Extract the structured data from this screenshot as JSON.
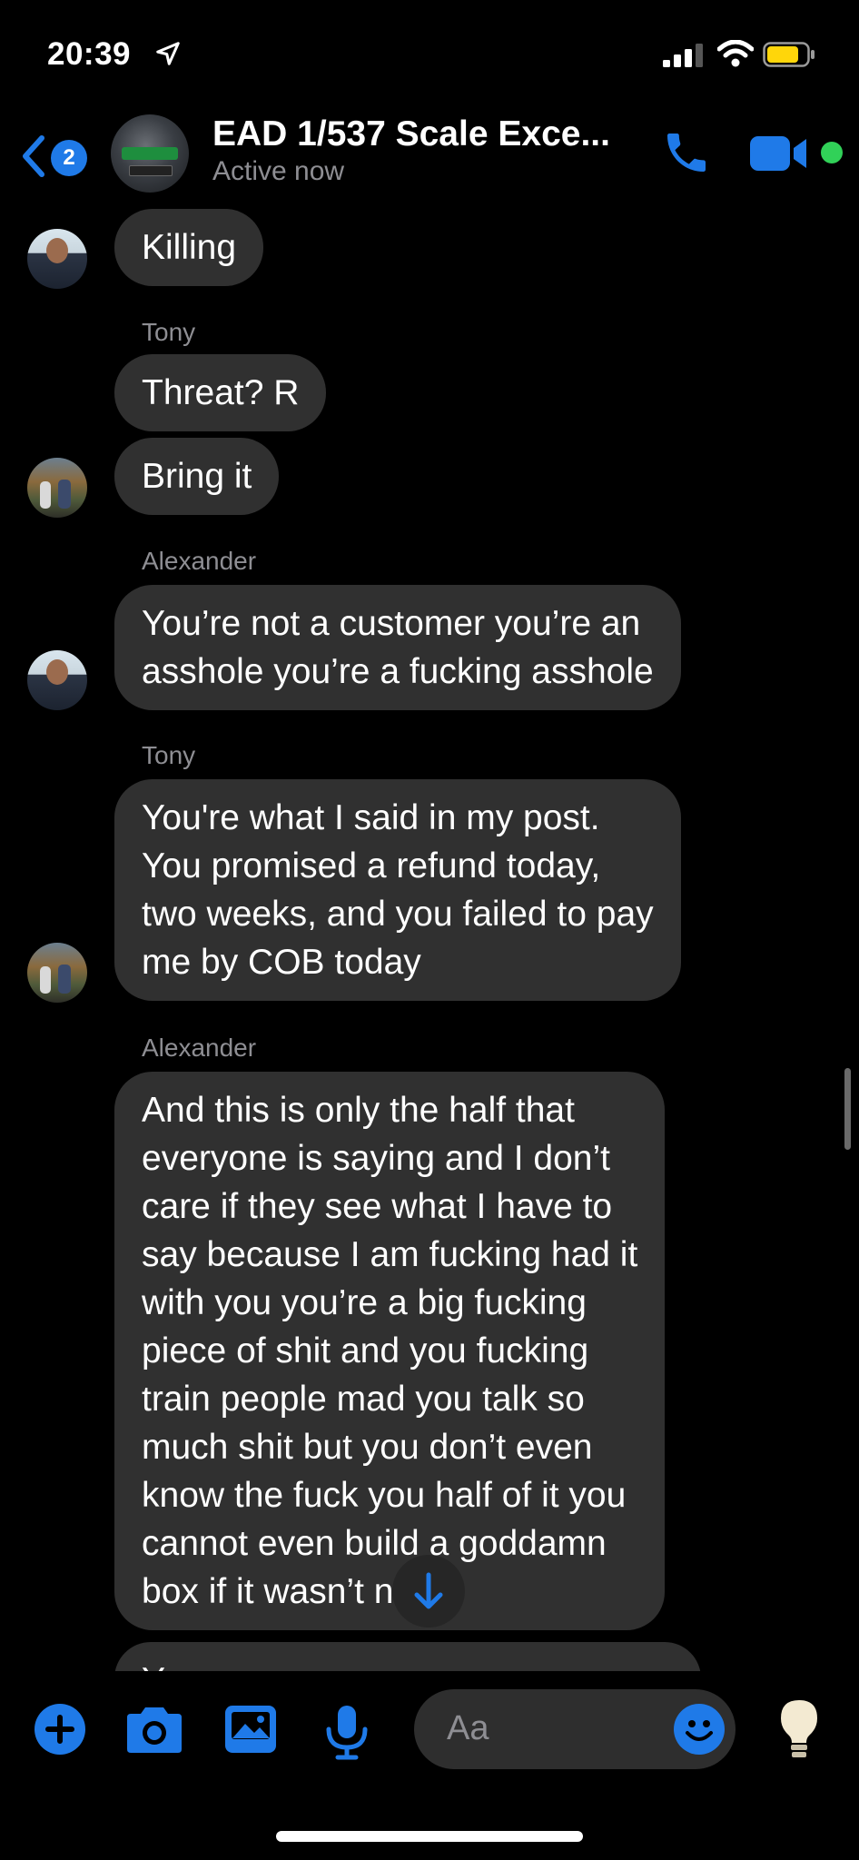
{
  "status_bar": {
    "time": "20:39"
  },
  "header": {
    "unread_count": "2",
    "title": "EAD 1/537  Scale Exce...",
    "subtitle": "Active now"
  },
  "messages": [
    {
      "text": "Killing",
      "avatar": "alexander"
    },
    {
      "sender": "Tony"
    },
    {
      "text": "Threat?  R"
    },
    {
      "text": "Bring it",
      "avatar": "tony"
    },
    {
      "sender": "Alexander"
    },
    {
      "text": "You’re not a customer you’re an\nasshole you’re a fucking asshole",
      "avatar": "alexander"
    },
    {
      "sender": "Tony"
    },
    {
      "text": "You're what I said in my post.\nYou promised a refund today,\ntwo weeks, and you failed to pay\nme by COB today",
      "avatar": "tony"
    },
    {
      "sender": "Alexander"
    },
    {
      "text": "And this is only the half that\neveryone is saying and I don’t\ncare if they see what I have to\nsay because I am fucking had it\nwith you you’re a big fucking\npiece of shit and you fucking\ntrain people mad you talk so\nmuch shit but you don’t even\nknow the fuck you half of it you\ncannot even build a goddamn\nbox if it wasn’t        ng"
    },
    {
      "text": "Y"
    }
  ],
  "composer": {
    "placeholder": "Aa"
  },
  "icons": {
    "accent": "#1f7ae8",
    "active_status": "#31d158",
    "battery_fill": "#ffd60a"
  }
}
